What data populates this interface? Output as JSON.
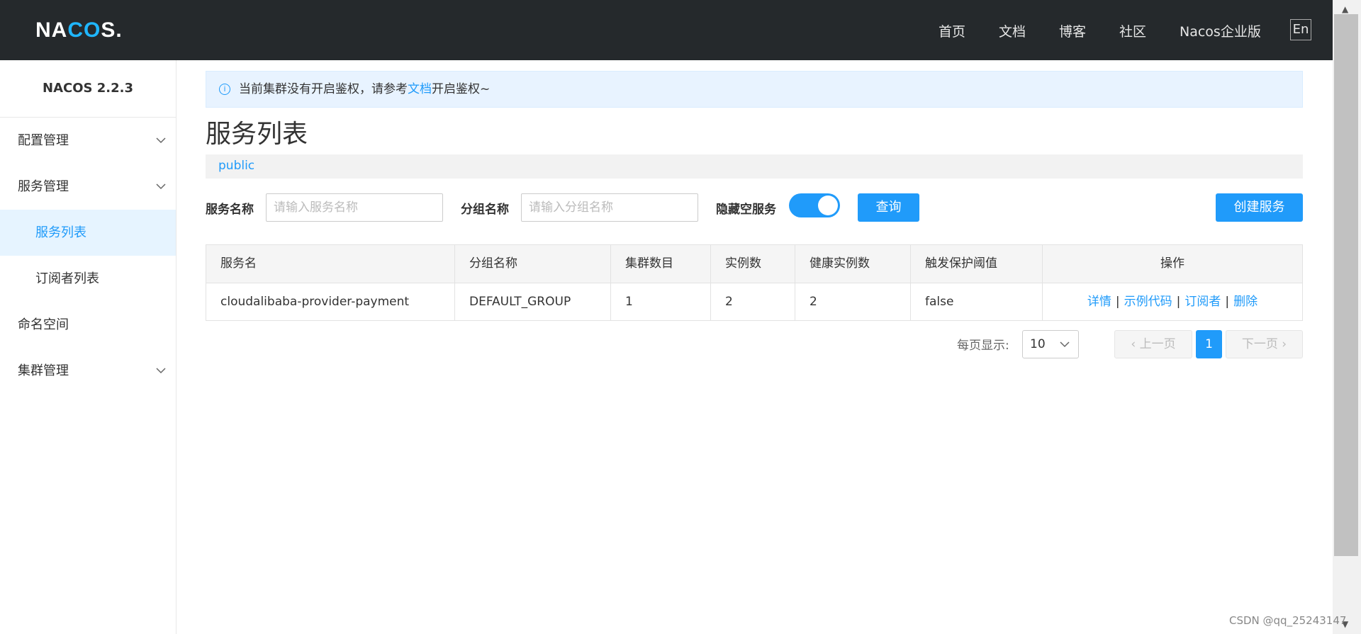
{
  "header": {
    "logo_pre": "NA",
    "logo_mid": "CO",
    "logo_post": "S.",
    "nav": [
      "首页",
      "文档",
      "博客",
      "社区",
      "Nacos企业版"
    ],
    "lang": "En"
  },
  "sidebar": {
    "version": "NACOS 2.2.3",
    "items": [
      {
        "label": "配置管理",
        "expandable": true
      },
      {
        "label": "服务管理",
        "expandable": true
      },
      {
        "label": "服务列表",
        "active": true
      },
      {
        "label": "订阅者列表"
      },
      {
        "label": "命名空间"
      },
      {
        "label": "集群管理",
        "expandable": true
      }
    ]
  },
  "alert": {
    "prefix": "当前集群没有开启鉴权，请参考",
    "link": "文档",
    "suffix": "开启鉴权~"
  },
  "page_title": "服务列表",
  "namespace": "public",
  "filters": {
    "service_label": "服务名称",
    "service_placeholder": "请输入服务名称",
    "group_label": "分组名称",
    "group_placeholder": "请输入分组名称",
    "hide_empty_label": "隐藏空服务",
    "hide_empty_on": true,
    "query_button": "查询",
    "create_button": "创建服务"
  },
  "table": {
    "headers": [
      "服务名",
      "分组名称",
      "集群数目",
      "实例数",
      "健康实例数",
      "触发保护阈值",
      "操作"
    ],
    "rows": [
      [
        "cloudalibaba-provider-payment",
        "DEFAULT_GROUP",
        "1",
        "2",
        "2",
        "false"
      ]
    ],
    "actions": [
      "详情",
      "示例代码",
      "订阅者",
      "删除"
    ]
  },
  "pagination": {
    "per_page_label": "每页显示:",
    "per_page": "10",
    "prev": "上一页",
    "next": "下一页",
    "current_page": "1"
  },
  "watermark": "CSDN @qq_25243147",
  "colors": {
    "accent": "#209bfa",
    "topbar": "#25292c"
  }
}
